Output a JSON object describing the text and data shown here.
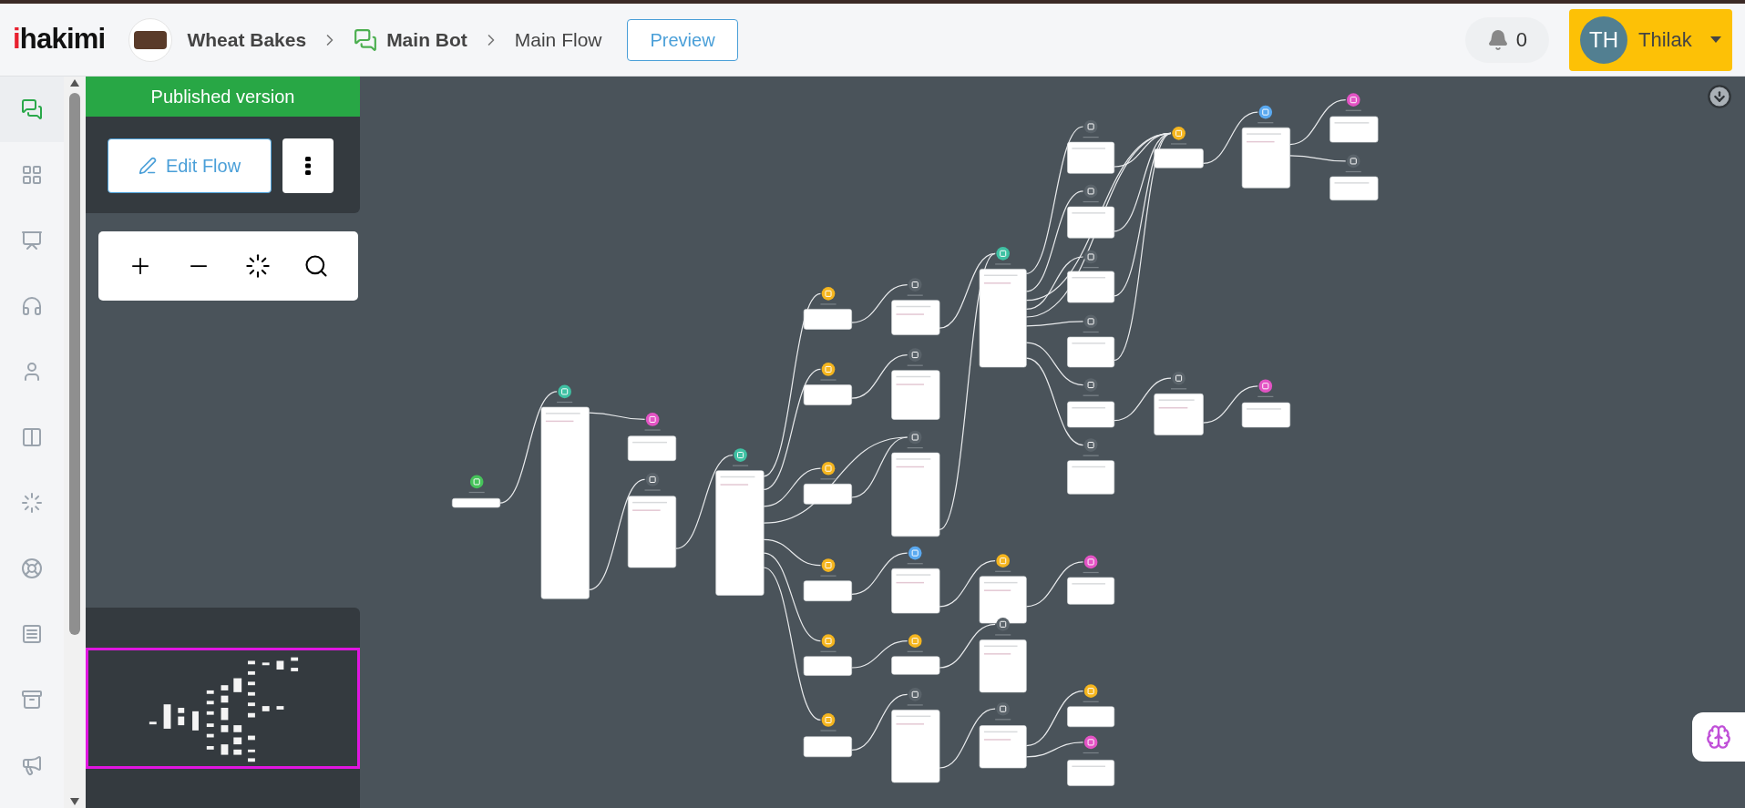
{
  "header": {
    "logo": "ihakimi",
    "breadcrumbs": [
      {
        "kind": "workspace",
        "label": "Wheat Bakes"
      },
      {
        "kind": "bot",
        "label": "Main Bot"
      },
      {
        "kind": "flow",
        "label": "Main Flow"
      }
    ],
    "preview_button": "Preview",
    "notifications": {
      "count": "0"
    },
    "user": {
      "initials": "TH",
      "name": "Thilak"
    }
  },
  "nav_rail": {
    "items": [
      {
        "kind": "chat",
        "selected": true
      },
      {
        "kind": "dashboard",
        "selected": false
      },
      {
        "kind": "reports",
        "selected": false
      },
      {
        "kind": "support",
        "selected": false
      },
      {
        "kind": "contacts",
        "selected": false
      },
      {
        "kind": "layout",
        "selected": false
      },
      {
        "kind": "magic",
        "selected": false
      },
      {
        "kind": "help",
        "selected": false
      },
      {
        "kind": "counter",
        "selected": false
      },
      {
        "kind": "archive",
        "selected": false
      },
      {
        "kind": "broadcast",
        "selected": false
      }
    ]
  },
  "panel": {
    "status_banner": "Published version",
    "edit_button": "Edit Flow"
  }
}
